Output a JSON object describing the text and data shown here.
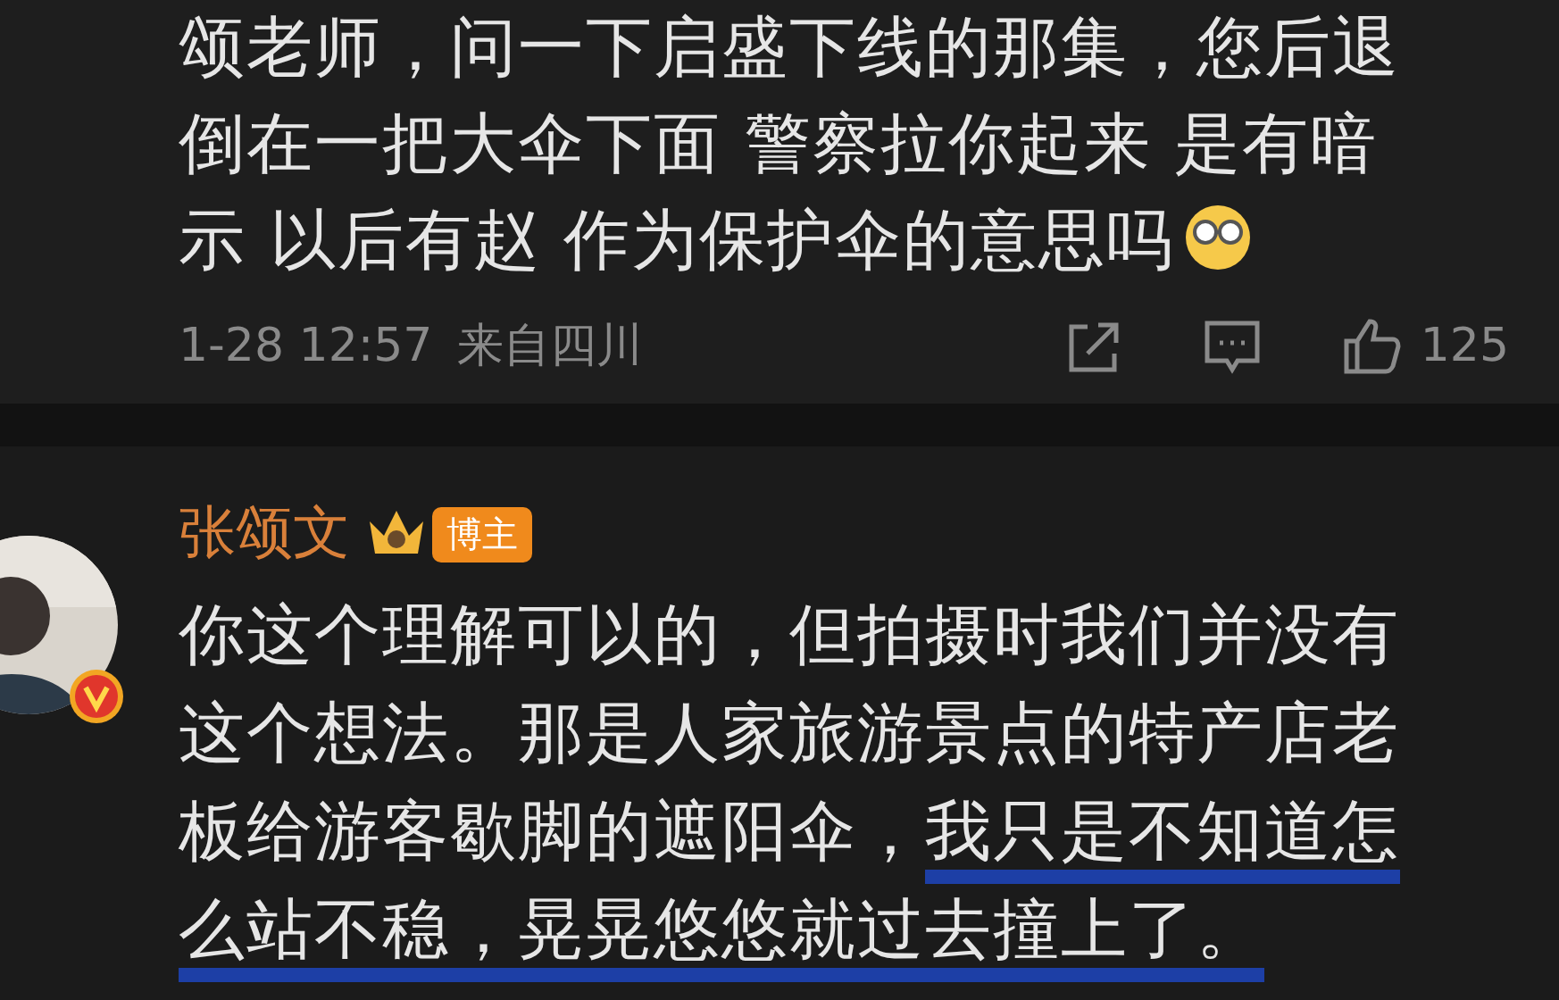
{
  "comment": {
    "lines": [
      "颂老师，问一下启盛下线的那集，您后退",
      "倒在一把大伞下面 警察拉你起来 是有暗",
      "示 以后有赵 作为保护伞的意思吗"
    ],
    "time": "1-28 12:57",
    "location": "来自四川",
    "likes": "125"
  },
  "reply": {
    "author": "张颂文",
    "badge": "博主",
    "verified": true,
    "segments": [
      {
        "text": "你这个理解可以的，但拍摄时我们并没有这个想法。那是人家旅游景点的特产店老板给游客歇脚的遮阳伞，",
        "underlined": false
      },
      {
        "text": "我只是不知道怎么站不稳，晃晃悠悠就过去撞上了。",
        "underlined": true
      }
    ]
  }
}
